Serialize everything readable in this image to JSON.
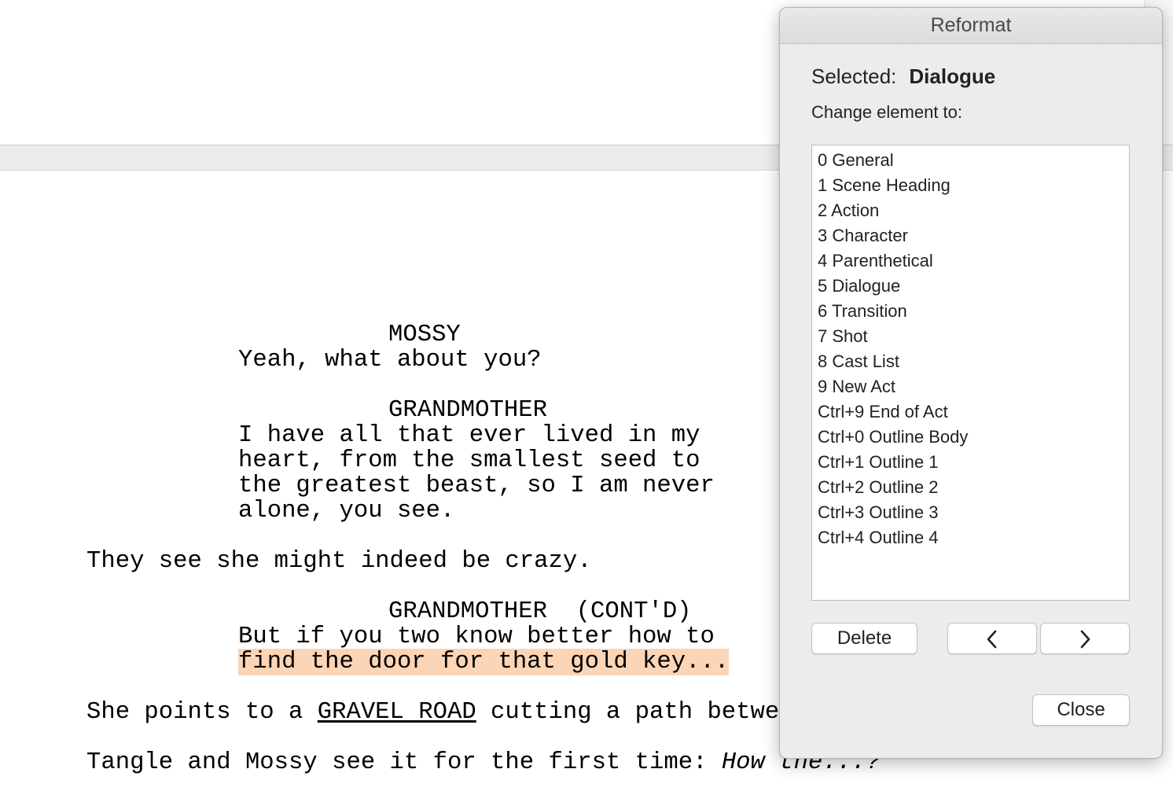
{
  "script": {
    "lines": {
      "mossy_char": "MOSSY",
      "mossy_dialogue": "Yeah, what about you?",
      "grandmother_char": "GRANDMOTHER",
      "grandmother_d1": "I have all that ever lived in my",
      "grandmother_d2": "heart, from the smallest seed to",
      "grandmother_d3": "the greatest beast, so I am never",
      "grandmother_d4": "alone, you see.",
      "action1": "They see she might indeed be crazy.",
      "grandmother_char2": "GRANDMOTHER  (CONT'D)",
      "grandmother2_d1": "But if you two know better how to",
      "grandmother2_d2_highlighted": "find the door for that gold key...",
      "action2_before": "She points to a ",
      "action2_underlined": "GRAVEL ROAD",
      "action2_after": " cutting a path betwe",
      "action3_before": "Tangle and Mossy see it for the first time: ",
      "action3_italic": "How the...?"
    },
    "highlight_color": "#fbd5b5"
  },
  "panel": {
    "title": "Reformat",
    "selected_label": "Selected:",
    "selected_value": "Dialogue",
    "change_label": "Change element to:",
    "elements": [
      "0 General",
      "1 Scene Heading",
      "2 Action",
      "3 Character",
      "4 Parenthetical",
      "5 Dialogue",
      "6 Transition",
      "7 Shot",
      "8 Cast List",
      "9 New Act",
      "Ctrl+9 End of Act",
      "Ctrl+0 Outline Body",
      "Ctrl+1 Outline 1",
      "Ctrl+2 Outline 2",
      "Ctrl+3 Outline 3",
      "Ctrl+4 Outline 4"
    ],
    "buttons": {
      "delete": "Delete",
      "prev_icon": "chevron-left-icon",
      "next_icon": "chevron-right-icon",
      "close": "Close"
    }
  }
}
